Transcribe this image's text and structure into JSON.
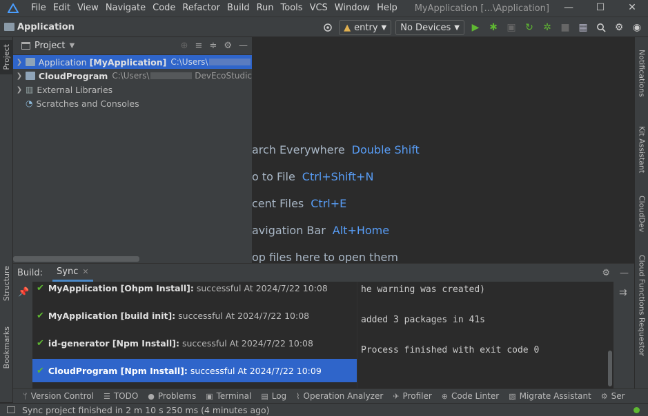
{
  "menubar": {
    "items": [
      "File",
      "Edit",
      "View",
      "Navigate",
      "Code",
      "Refactor",
      "Build",
      "Run",
      "Tools",
      "VCS",
      "Window",
      "Help"
    ],
    "window_title": "MyApplication [...\\Application]",
    "minimize": "—",
    "maximize": "☐",
    "close": "✕"
  },
  "toolbar": {
    "breadcrumb": "Application",
    "run_config": "entry",
    "device": "No Devices"
  },
  "left_strip": {
    "project_tab": "Project",
    "structure_tab": "Structure",
    "bookmarks_tab": "Bookmarks"
  },
  "right_strip": {
    "notifications": "Notifications",
    "kit_assistant": "Kit Assistant",
    "clouddev": "CloudDev",
    "cloud_functions": "Cloud Functions Requestor"
  },
  "project_panel": {
    "title": "Project",
    "tree": [
      {
        "name": "Application",
        "module": "[MyApplication]",
        "path": "C:\\Users\\"
      },
      {
        "name": "CloudProgram",
        "path": "C:\\Users\\",
        "path_tail": "DevEcoStudic"
      },
      {
        "name": "External Libraries"
      },
      {
        "name": "Scratches and Consoles"
      }
    ]
  },
  "editor_hints": [
    {
      "text": "arch Everywhere",
      "key": "Double Shift"
    },
    {
      "text": "o to File",
      "key": "Ctrl+Shift+N"
    },
    {
      "text": "cent Files",
      "key": "Ctrl+E"
    },
    {
      "text": "avigation Bar",
      "key": "Alt+Home"
    },
    {
      "text": "op files here to open them",
      "key": ""
    }
  ],
  "build_panel": {
    "label": "Build:",
    "tab": "Sync",
    "items": [
      {
        "name": "MyApplication [Ohpm Install]:",
        "rest": "successful At 2024/7/22 10:08"
      },
      {
        "name": "MyApplication [build init]:",
        "rest": "successful At 2024/7/22 10:08"
      },
      {
        "name": "id-generator [Npm Install]:",
        "rest": "successful At 2024/7/22 10:08"
      },
      {
        "name": "CloudProgram [Npm Install]:",
        "rest": "successful At 2024/7/22 10:09"
      }
    ],
    "console": [
      "he warning was created)",
      "added 3 packages in 41s",
      "Process finished with exit code 0"
    ]
  },
  "tool_windows": [
    "Version Control",
    "TODO",
    "Problems",
    "Terminal",
    "Log",
    "Operation Analyzer",
    "Profiler",
    "Code Linter",
    "Migrate Assistant",
    "Ser"
  ],
  "status": {
    "message": "Sync project finished in 2 m 10 s 250 ms (4 minutes ago)"
  },
  "colors": {
    "selection": "#2f65ca",
    "link_key": "#589df6",
    "success": "#5fb832"
  }
}
